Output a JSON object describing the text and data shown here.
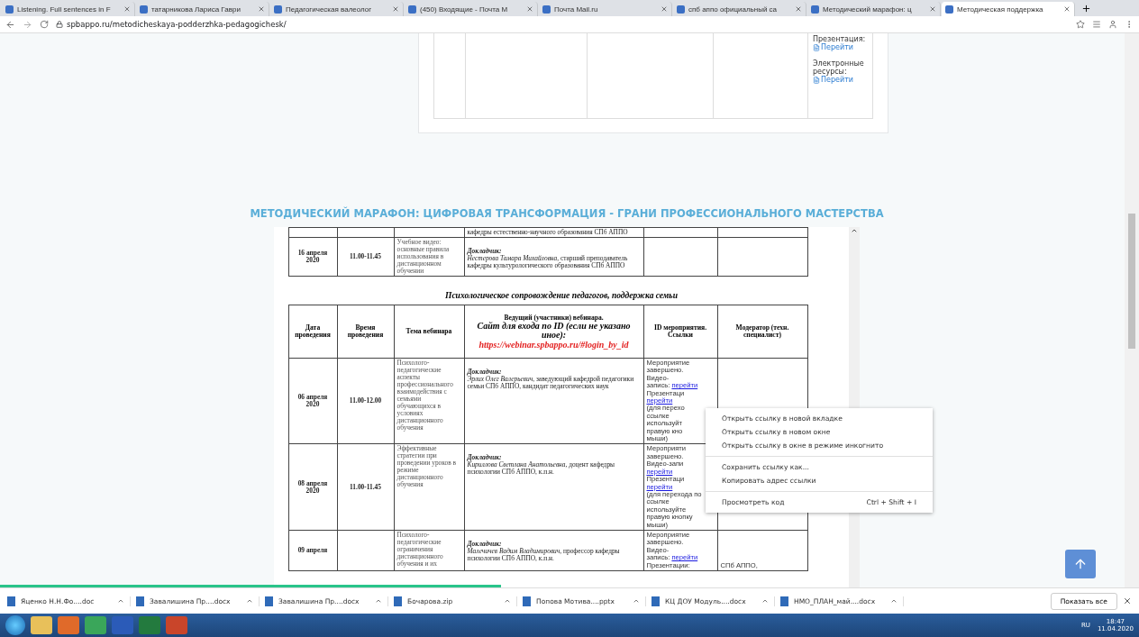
{
  "browser": {
    "tabs": [
      {
        "title": "Listening. Full sentences in F",
        "selected": false
      },
      {
        "title": "татарникова Лариса Гаври",
        "selected": false
      },
      {
        "title": "Педагогическая валеолог",
        "selected": false
      },
      {
        "title": "(450) Входящие - Почта М",
        "selected": false
      },
      {
        "title": "Почта Mail.ru",
        "selected": false
      },
      {
        "title": "спб аппо официальный са",
        "selected": false
      },
      {
        "title": "Методический марафон: ц",
        "selected": false
      },
      {
        "title": "Методическая поддержка",
        "selected": true
      }
    ],
    "address": "spbappo.ru/metodicheskaya-podderzhka-pedagogichesk/"
  },
  "top_card": {
    "materials": [
      {
        "label": "Презентация:",
        "link": "Перейти"
      },
      {
        "label": "Электронные ресурсы:",
        "link": "Перейти"
      }
    ]
  },
  "heading": "МЕТОДИЧЕСКИЙ МАРАФОН: ЦИФРОВАЯ ТРАНСФОРМАЦИЯ - ГРАНИ ПРОФЕССИОНАЛЬНОГО МАСТЕРСТВА",
  "document": {
    "upper_rows": [
      {
        "date": "",
        "time": "",
        "topic": "",
        "speaker_label": "",
        "speaker": "кафедры естественно-научного образования  СПб АППО"
      },
      {
        "date": "16 апреля 2020",
        "time": "11.00-11.45",
        "topic": "Учебное видео: основные правила использования в дистанционном обучении",
        "speaker_label": "Докладчик:",
        "speaker": "*Нестерова Тамара Михайловна*, старший преподаватель кафедры культурологического образования СПб АППО"
      }
    ],
    "section_title": "Психологическое сопровождение педагогов, поддержка семьи",
    "columns": [
      "Дата проведения",
      "Время проведения",
      "Тема вебинара",
      {
        "line1": "Ведущий (участники) вебинара.",
        "line2": "Сайт для входа по ID (если не указано иное):",
        "url": "https://webinar.spbappo.ru/#login_by_id"
      },
      "ID мероприятия. Ссылки",
      "Модератор (техн. специалист)"
    ],
    "rows": [
      {
        "date": "06 апреля 2020",
        "time": "11.00-12.00",
        "topic": "Психолого-педагогические аспекты профессионального взаимодействия с семьями обучающихся в условиях дистанционного обучения",
        "speaker_label": "Докладчик:",
        "speaker": "*Эрлих Олег Валерьевич*, заведующий кафедрой педагогики семьи СПб АППО,  кандидат педагогических наук",
        "links": [
          {
            "text": "Мероприятие"
          },
          {
            "text": "завершено."
          },
          {
            "text": "Видео-"
          },
          {
            "text": "запись:",
            "link": "перейти"
          },
          {
            "text": "Презентаци"
          },
          {
            "link": "перейти"
          },
          {
            "text": "(для перехо"
          },
          {
            "text": "ссылке"
          },
          {
            "text": "используйт"
          },
          {
            "text": "правую кно"
          },
          {
            "text": "мыши)"
          }
        ],
        "moderator": []
      },
      {
        "date": "08 апреля 2020",
        "time": "11.00-11.45",
        "topic": "Эффективные стратегии при проведении уроков в режиме дистанционного обучения",
        "speaker_label": "Докладчик:",
        "speaker": "*Кириллова Светлана Анатольевна*, доцент кафедры психологии СПб АППО, к.п.н.",
        "links": [
          {
            "text": "Мероприяти"
          },
          {
            "text": "завершено."
          },
          {
            "text": "Видео-запи"
          },
          {
            "link": "перейти"
          },
          {
            "text": "Презентаци"
          },
          {
            "link": "перейти"
          },
          {
            "text": "(для перехода по"
          },
          {
            "text": "ссылке"
          },
          {
            "text": "используйте"
          },
          {
            "text": "правую кнопку"
          },
          {
            "text": "мыши)"
          }
        ],
        "moderator": []
      },
      {
        "date": "09 апреля",
        "time": "",
        "topic": "Психолого-педагогические ограничения дистанционного обучения  и их",
        "speaker_label": "Докладчик:",
        "speaker": "*Малечичев Вадим Владимирович*, профессор кафедры психологии СПб АППО, к.п.н.",
        "links": [
          {
            "text": "Мероприятие"
          },
          {
            "text": "завершено."
          },
          {
            "text": "Видео-"
          },
          {
            "text": "запись:",
            "link": "перейти"
          },
          {
            "text": "Презентации:"
          }
        ],
        "moderator": [
          "СПб АППО,"
        ]
      }
    ]
  },
  "context_menu": [
    [
      {
        "label": "Открыть ссылку в новой вкладке"
      },
      {
        "label": "Открыть ссылку в новом окне"
      },
      {
        "label": "Открыть ссылку в окне в режиме инкогнито"
      }
    ],
    [
      {
        "label": "Сохранить ссылку как..."
      },
      {
        "label": "Копировать адрес ссылки"
      }
    ],
    [
      {
        "label": "Просмотреть код",
        "shortcut": "Ctrl + Shift + I"
      }
    ]
  ],
  "page_loading": {
    "level": 0.44
  },
  "downloads": {
    "items": [
      "Яценко Н.Н.Фо....doc",
      "Завалишина Пр....docx",
      "Завалишина Пр....docx",
      "Бочарова.zip",
      "Попова Мотива....pptx",
      "КЦ ДОУ Модуль....docx",
      "НМО_ПЛАН_май....docx"
    ],
    "show_all": "Показать все"
  },
  "taskbar": {
    "language": "RU",
    "time": "18:47",
    "date": "11.04.2020"
  }
}
